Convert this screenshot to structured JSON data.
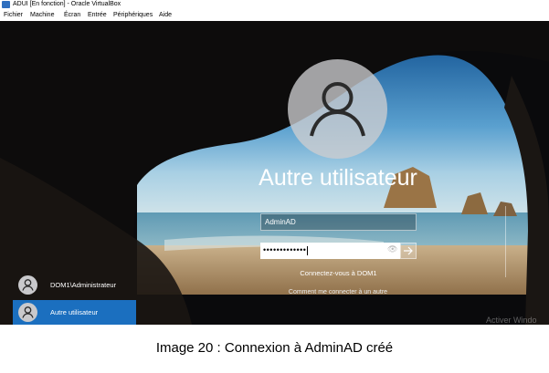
{
  "window": {
    "title": "ADUI [En fonction] - Oracle VirtualBox",
    "icon": "virtualbox-icon"
  },
  "menu": [
    "Fichier",
    "Machine",
    "Écran",
    "Entrée",
    "Périphériques",
    "Aide"
  ],
  "login": {
    "avatar_icon": "user-icon",
    "display_name": "Autre utilisateur",
    "username_value": "AdminAD",
    "password_mask": "•••••••••••••",
    "reveal_icon": "eye-icon",
    "submit_icon": "arrow-right-icon",
    "sign_in_to": "Connectez-vous à DOM1",
    "how_to_sign_in": "Comment me connecter à un autre"
  },
  "user_list": [
    {
      "label": "DOM1\\Administrateur",
      "selected": false
    },
    {
      "label": "Autre utilisateur",
      "selected": true
    }
  ],
  "watermark": "Activer Windo",
  "caption": "Image 20 : Connexion à AdminAD créé",
  "colors": {
    "selected_user": "#1b6fbf",
    "text": "#ffffff"
  }
}
